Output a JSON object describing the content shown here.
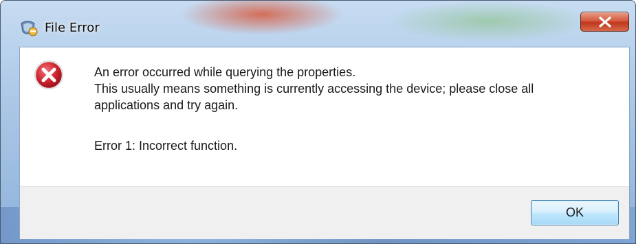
{
  "window": {
    "title": "File Error",
    "icon": "app-shield-icon",
    "close_icon": "close-icon"
  },
  "message": {
    "icon": "error-x-icon",
    "line1": "An error occurred while querying the properties.",
    "line2": "This usually means something is currently accessing the device; please close all",
    "line3": "applications and try again.",
    "line4": "Error 1: Incorrect function."
  },
  "buttons": {
    "ok_label": "OK"
  },
  "colors": {
    "close_button": "#c7452a",
    "error_icon": "#c8202c",
    "ok_button_border": "#3c7fb1",
    "footer_bg": "#f0f0f0"
  }
}
